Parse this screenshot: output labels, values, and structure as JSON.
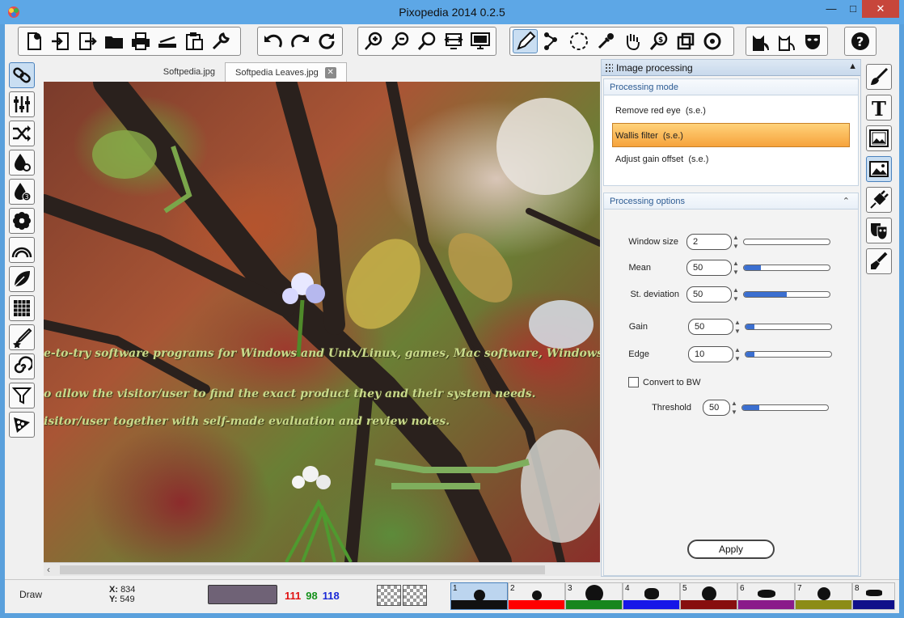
{
  "window": {
    "title": "Pixopedia 2014 0.2.5",
    "min": "—",
    "max": "□",
    "close": "✕"
  },
  "tabs": [
    {
      "label": "Softpedia.jpg"
    },
    {
      "label": "Softpedia Leaves.jpg",
      "close": "✕"
    }
  ],
  "canvas_text": [
    "e-to-try software programs for Windows and Unix/Linux, games, Mac software, Windows drivers, mo",
    "o allow the visitor/user to find the exact product they and their system needs.",
    "isitor/user together with self-made evaluation and review notes."
  ],
  "panel": {
    "title": "Image processing",
    "mode_title": "Processing mode",
    "modes": [
      {
        "label": "Remove red eye",
        "suffix": "(s.e.)"
      },
      {
        "label": "Wallis filter",
        "suffix": "(s.e.)"
      },
      {
        "label": "Adjust gain offset",
        "suffix": "(s.e.)"
      }
    ],
    "selected_mode": "Wallis filter",
    "options_title": "Processing options",
    "options": [
      {
        "label": "Window size",
        "value": "2",
        "level": 0.0
      },
      {
        "label": "Mean",
        "value": "50",
        "level": 0.2
      },
      {
        "label": "St. deviation",
        "value": "50",
        "level": 0.5
      },
      {
        "label": "Gain",
        "value": "50",
        "level": 0.1
      },
      {
        "label": "Edge",
        "value": "10",
        "level": 0.1
      }
    ],
    "convert_bw": {
      "label": "Convert to BW",
      "checked": false
    },
    "threshold": {
      "label": "Threshold",
      "value": "50",
      "level": 0.2
    },
    "apply": "Apply"
  },
  "status": {
    "mode": "Draw",
    "x_label": "X:",
    "x": "834",
    "y_label": "Y:",
    "y": "549",
    "color": "#6f6276",
    "r": "111",
    "g": "98",
    "b": "118"
  },
  "brushes": [
    {
      "num": "1",
      "color": "#111111"
    },
    {
      "num": "2",
      "color": "#ff0000"
    },
    {
      "num": "3",
      "color": "#17861d"
    },
    {
      "num": "4",
      "color": "#1616e8"
    },
    {
      "num": "5",
      "color": "#870e0e"
    },
    {
      "num": "6",
      "color": "#8a1a8a"
    },
    {
      "num": "7",
      "color": "#8c8c16"
    },
    {
      "num": "8",
      "color": "#0f0f8a"
    }
  ]
}
